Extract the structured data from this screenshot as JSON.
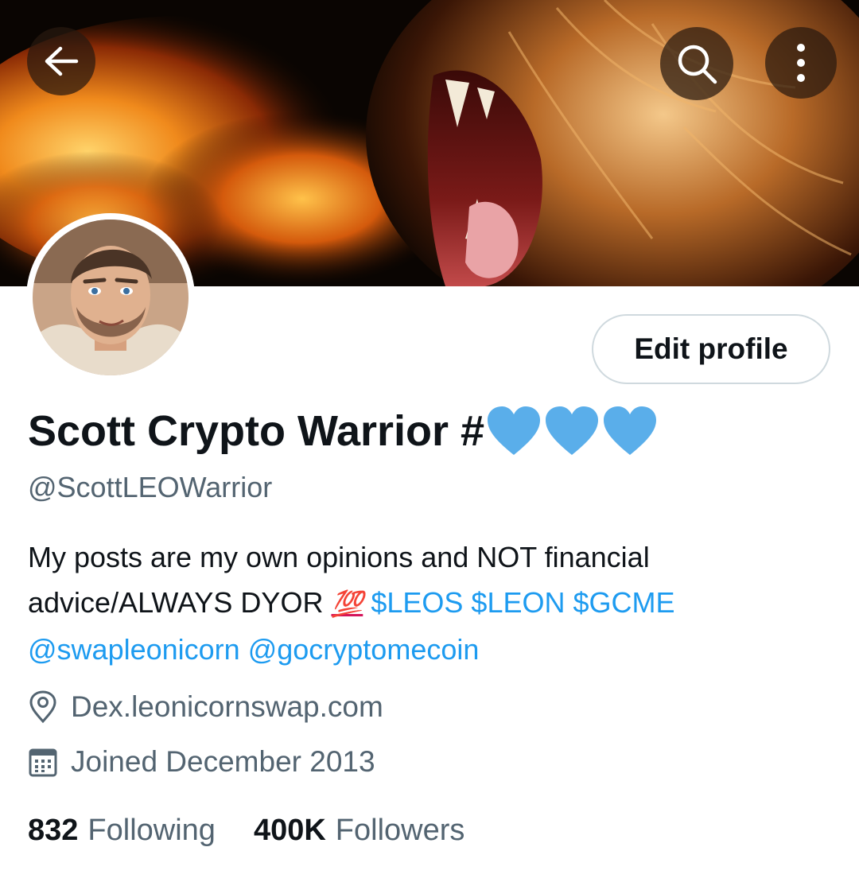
{
  "header": {
    "back_icon": "arrow-left-icon",
    "search_icon": "search-icon",
    "more_icon": "more-vertical-icon"
  },
  "profile": {
    "display_name": "Scott Crypto Warrior #",
    "name_emojis": [
      "blue-heart",
      "blue-heart",
      "blue-heart"
    ],
    "handle": "@ScottLEOWarrior",
    "edit_button_label": "Edit profile",
    "bio": {
      "text": "My posts are my own opinions and NOT financial advice/ALWAYS DYOR",
      "emoji": "💯",
      "cashtags": [
        "$LEOS",
        "$LEON",
        "$GCME"
      ],
      "mentions": [
        "@swapleonicorn",
        "@gocryptomecoin"
      ]
    },
    "location": "Dex.leonicornswap.com",
    "joined": "Joined December 2013"
  },
  "stats": {
    "following_count": "832",
    "following_label": "Following",
    "followers_count": "400K",
    "followers_label": "Followers"
  },
  "colors": {
    "link": "#1d9bf0",
    "secondary_text": "#536471",
    "primary_text": "#0f1419",
    "heart": "#5aaeea"
  }
}
